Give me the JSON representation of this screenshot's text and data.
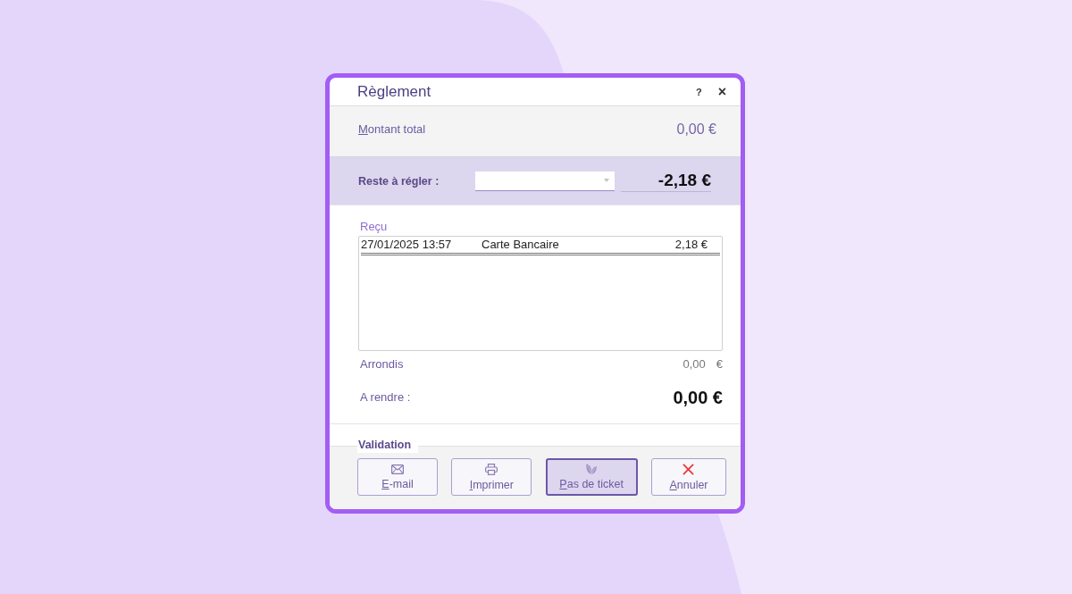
{
  "dialog": {
    "title": "Règlement",
    "title_bar_buttons": [
      {
        "kind": "help",
        "label": "?"
      },
      {
        "kind": "close",
        "label": "×"
      }
    ]
  },
  "total": {
    "label": "Montant total",
    "access_key": true,
    "value": "0,00 €"
  },
  "remaining": {
    "label": "Reste à régler :",
    "value": "-2,18 €"
  },
  "received": {
    "label": "Reçu",
    "rows": [
      {
        "date": "27/01/2025 13:57",
        "method": "Carte Bancaire",
        "amount": "2,18 €"
      }
    ]
  },
  "rounding": {
    "label": "Arrondis",
    "amount": "0,00",
    "currency": "€"
  },
  "change_due": {
    "label": "A rendre :",
    "value": "0,00 €"
  },
  "validation": {
    "legend": "Validation",
    "buttons": [
      {
        "kind": "email",
        "label": "E-mail",
        "access_key": true,
        "default": false
      },
      {
        "kind": "print",
        "label": "Imprimer",
        "access_key": true,
        "default": false
      },
      {
        "kind": "no_ticket",
        "label": "Pas de ticket",
        "access_key": true,
        "default": true
      },
      {
        "kind": "cancel",
        "label": "Annuler",
        "access_key": true,
        "default": false
      }
    ]
  }
}
